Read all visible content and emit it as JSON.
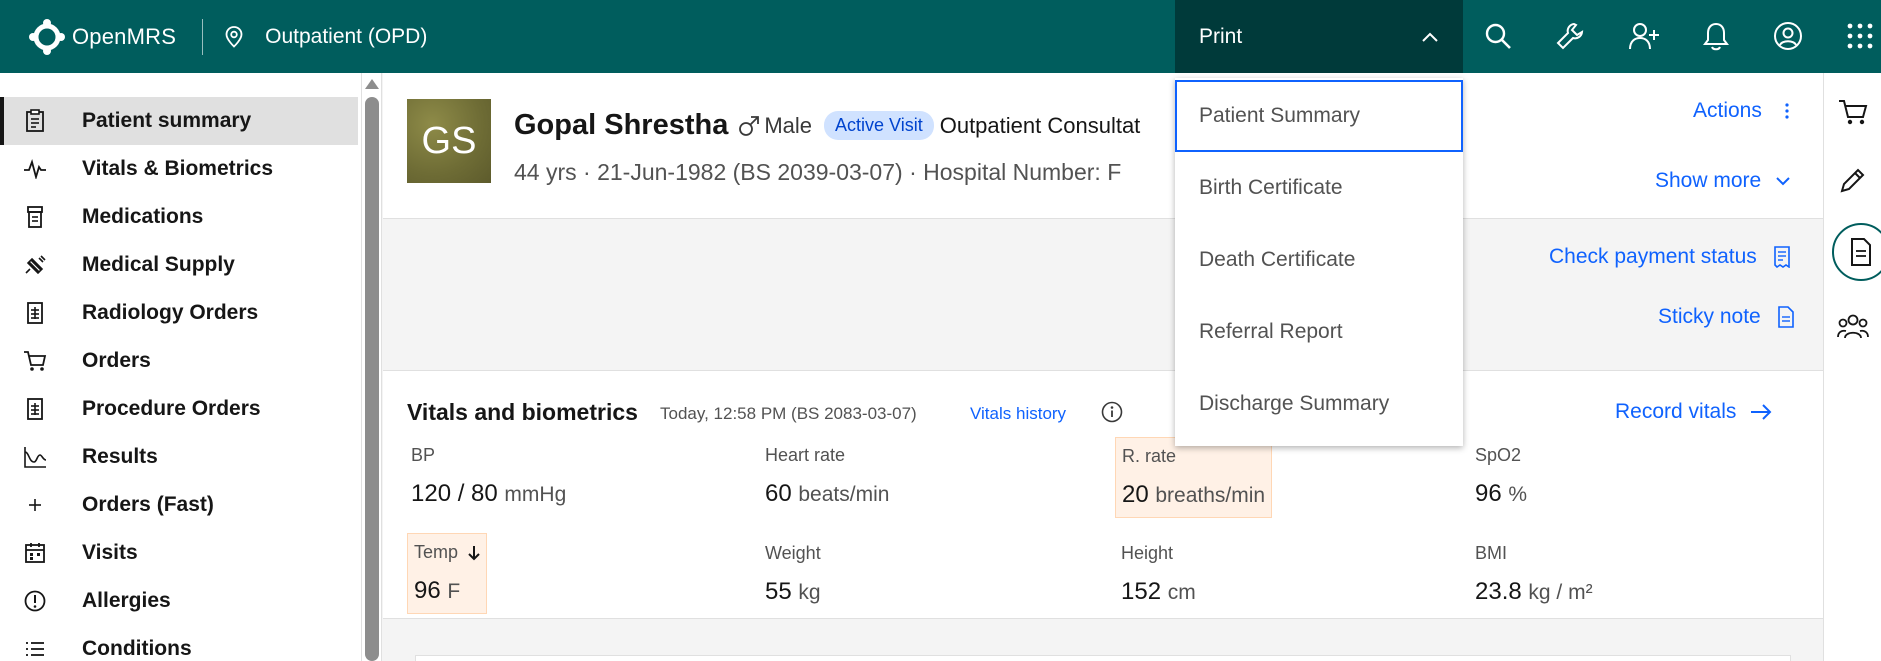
{
  "header": {
    "brand": "OpenMRS",
    "location": "Outpatient (OPD)",
    "print_label": "Print",
    "icons": [
      "search-icon",
      "wrench-icon",
      "add-user-icon",
      "bell-icon",
      "user-avatar-icon",
      "app-switcher-icon"
    ]
  },
  "print_menu": {
    "items": [
      "Patient Summary",
      "Birth Certificate",
      "Death Certificate",
      "Referral Report",
      "Discharge Summary"
    ]
  },
  "sidebar": {
    "items": [
      {
        "label": "Patient summary",
        "icon": "clipboard-icon"
      },
      {
        "label": "Vitals & Biometrics",
        "icon": "activity-icon"
      },
      {
        "label": "Medications",
        "icon": "medication-icon"
      },
      {
        "label": "Medical Supply",
        "icon": "syringe-icon"
      },
      {
        "label": "Radiology Orders",
        "icon": "order-document-icon"
      },
      {
        "label": "Orders",
        "icon": "cart-icon"
      },
      {
        "label": "Procedure Orders",
        "icon": "order-document-icon"
      },
      {
        "label": "Results",
        "icon": "results-chart-icon"
      },
      {
        "label": "Orders (Fast)",
        "icon": "plus-icon"
      },
      {
        "label": "Visits",
        "icon": "calendar-icon"
      },
      {
        "label": "Allergies",
        "icon": "warning-circle-icon"
      },
      {
        "label": "Conditions",
        "icon": "list-icon"
      }
    ]
  },
  "patient": {
    "initials": "GS",
    "name": "Gopal Shrestha",
    "gender": "Male",
    "visit_badge": "Active Visit",
    "visit_type": "Outpatient Consultat",
    "age": "44 yrs",
    "dob": "21-Jun-1982 (BS 2039-03-07)",
    "hospital_number": "Hospital Number: F",
    "actions_label": "Actions",
    "show_more_label": "Show more"
  },
  "links": {
    "check_payment": "Check payment status",
    "sticky_note": "Sticky note"
  },
  "vitals": {
    "title": "Vitals and biometrics",
    "timestamp": "Today, 12:58 PM (BS 2083-03-07)",
    "history_link": "Vitals history",
    "record_label": "Record vitals",
    "items": [
      {
        "label": "BP",
        "value": "120 / 80",
        "unit": "mmHg",
        "flag": ""
      },
      {
        "label": "Heart rate",
        "value": "60",
        "unit": "beats/min",
        "flag": ""
      },
      {
        "label": "R. rate",
        "value": "20",
        "unit": "breaths/min",
        "flag": "abnormal"
      },
      {
        "label": "SpO2",
        "value": "96",
        "unit": "%",
        "flag": ""
      },
      {
        "label": "Temp",
        "value": "96",
        "unit": "F",
        "flag": "low"
      },
      {
        "label": "Weight",
        "value": "55",
        "unit": "kg",
        "flag": ""
      },
      {
        "label": "Height",
        "value": "152",
        "unit": "cm",
        "flag": ""
      },
      {
        "label": "BMI",
        "value": "23.8",
        "unit": "kg / m²",
        "flag": ""
      }
    ]
  },
  "colors": {
    "header_bg": "#005d5d",
    "print_bg": "#003a3a",
    "link_blue": "#0f62fe",
    "badge_bg": "#d0e2ff",
    "warn_bg": "#fff1e6"
  }
}
